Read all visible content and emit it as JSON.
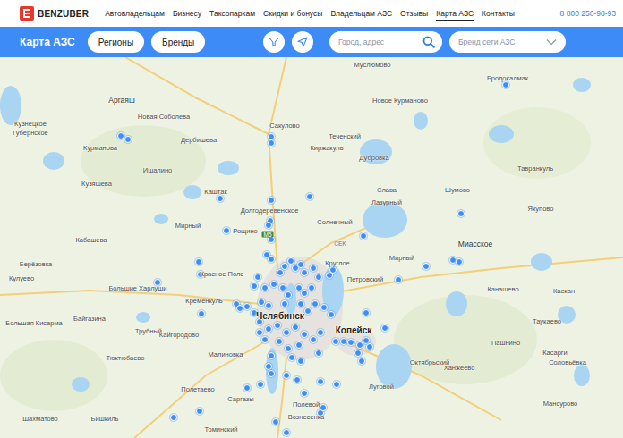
{
  "header": {
    "logo": "BENZUBER",
    "nav": [
      {
        "label": "Автовладельцам",
        "selected": false
      },
      {
        "label": "Бизнесу",
        "selected": false
      },
      {
        "label": "Таксопаркам",
        "selected": false
      },
      {
        "label": "Скидки и бонусы",
        "selected": false
      },
      {
        "label": "Владельцам АЗС",
        "selected": false
      },
      {
        "label": "Отзывы",
        "selected": false
      },
      {
        "label": "Карта АЗС",
        "selected": true
      },
      {
        "label": "Контакты",
        "selected": false
      }
    ],
    "phone": "8 800 250-98-93"
  },
  "toolbar": {
    "title": "Карта АЗС",
    "buttons": [
      {
        "label": "Регионы"
      },
      {
        "label": "Бренды"
      }
    ],
    "search": {
      "placeholder": "Город, адрес"
    },
    "brand_select": {
      "placeholder": "Бренд сети АЗС"
    }
  },
  "map": {
    "places": [
      {
        "name": "Муслюмово",
        "kind": "village"
      },
      {
        "name": "Бродокалмак",
        "kind": "village"
      },
      {
        "name": "Аргаяш",
        "kind": "town"
      },
      {
        "name": "Новое Курманово",
        "kind": "village"
      },
      {
        "name": "Новая Соболева",
        "kind": "village"
      },
      {
        "name": "Кузнецкое",
        "kind": "village"
      },
      {
        "name": "Губернское",
        "kind": "village"
      },
      {
        "name": "Сакулово",
        "kind": "village"
      },
      {
        "name": "Теченский",
        "kind": "village"
      },
      {
        "name": "Дербишева",
        "kind": "village"
      },
      {
        "name": "Курманова",
        "kind": "village"
      },
      {
        "name": "Киржакуль",
        "kind": "village"
      },
      {
        "name": "Дубровка",
        "kind": "village"
      },
      {
        "name": "Тавранкуль",
        "kind": "village"
      },
      {
        "name": "Ишалино",
        "kind": "village"
      },
      {
        "name": "Кузяшева",
        "kind": "village"
      },
      {
        "name": "Шумово",
        "kind": "village"
      },
      {
        "name": "Слава",
        "kind": "village"
      },
      {
        "name": "Каштак",
        "kind": "village"
      },
      {
        "name": "Лазурный",
        "kind": "village"
      },
      {
        "name": "Якупово",
        "kind": "village"
      },
      {
        "name": "Долгодеревенское",
        "kind": "village"
      },
      {
        "name": "Солнечный",
        "kind": "village"
      },
      {
        "name": "Мирный",
        "kind": "village"
      },
      {
        "name": "Рощино",
        "kind": "village"
      },
      {
        "name": "Кабашева",
        "kind": "village"
      },
      {
        "name": "CEK",
        "kind": "airport"
      },
      {
        "name": "Миасское",
        "kind": "town"
      },
      {
        "name": "Берёзовка",
        "kind": "village"
      },
      {
        "name": "Мирный",
        "kind": "village"
      },
      {
        "name": "Круглое",
        "kind": "village"
      },
      {
        "name": "Красное Поле",
        "kind": "village"
      },
      {
        "name": "Кулуево",
        "kind": "village"
      },
      {
        "name": "Петровский",
        "kind": "village"
      },
      {
        "name": "Большие Харлуши",
        "kind": "village"
      },
      {
        "name": "Канашево",
        "kind": "village"
      },
      {
        "name": "Каскан",
        "kind": "village"
      },
      {
        "name": "Кременкуль",
        "kind": "village"
      },
      {
        "name": "Челябинск",
        "kind": "city"
      },
      {
        "name": "Большая Кисарма",
        "kind": "village"
      },
      {
        "name": "Байгазина",
        "kind": "village"
      },
      {
        "name": "Таукаево",
        "kind": "village"
      },
      {
        "name": "Трубный",
        "kind": "village"
      },
      {
        "name": "Кайгородово",
        "kind": "village"
      },
      {
        "name": "Копейск",
        "kind": "city"
      },
      {
        "name": "Пашнино",
        "kind": "village"
      },
      {
        "name": "Тюктюбаево",
        "kind": "village"
      },
      {
        "name": "Малиновка",
        "kind": "village"
      },
      {
        "name": "Касарги",
        "kind": "village"
      },
      {
        "name": "Соловьёвка",
        "kind": "village"
      },
      {
        "name": "Октябрьский",
        "kind": "village"
      },
      {
        "name": "Ханжеево",
        "kind": "village"
      },
      {
        "name": "Полетаево",
        "kind": "village"
      },
      {
        "name": "Луговой",
        "kind": "village"
      },
      {
        "name": "Саргазы",
        "kind": "village"
      },
      {
        "name": "Мансурово",
        "kind": "village"
      },
      {
        "name": "Полевой",
        "kind": "village"
      },
      {
        "name": "Вознесенка",
        "kind": "village"
      },
      {
        "name": "Шахматово",
        "kind": "village"
      },
      {
        "name": "Бишкиль",
        "kind": "village"
      },
      {
        "name": "Томинский",
        "kind": "village"
      }
    ],
    "roads": [
      "М5"
    ]
  }
}
